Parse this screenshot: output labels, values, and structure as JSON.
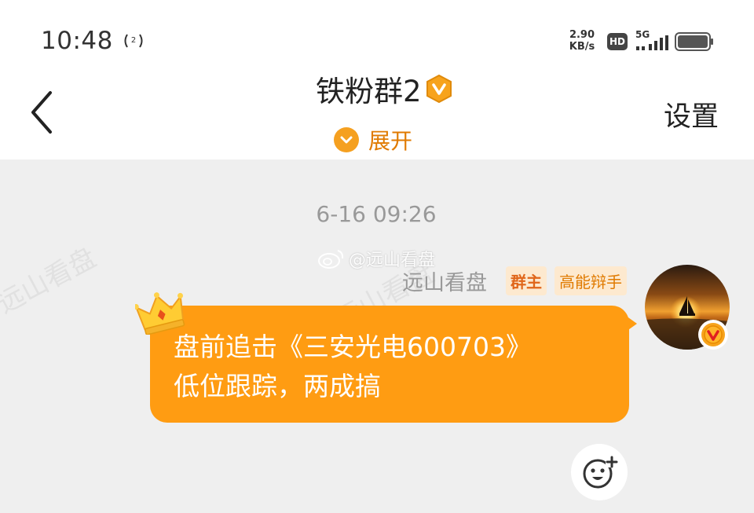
{
  "status_bar": {
    "time": "10:48",
    "speed_value": "2.90",
    "speed_unit": "KB/s",
    "hd_label": "HD",
    "network_label": "5G"
  },
  "header": {
    "title": "铁粉群2",
    "expand_label": "展开",
    "settings_label": "设置"
  },
  "chat": {
    "timestamp": "6-16 09:26",
    "watermark": "@远山看盘",
    "message": {
      "sender": "远山看盘",
      "tags": [
        "群主",
        "高能辩手"
      ],
      "lines": [
        "盘前追击《三安光电600703》",
        "低位跟踪，两成搞"
      ]
    }
  },
  "colors": {
    "accent": "#ff9c12",
    "expand_orange": "#e07a00",
    "tag_bg": "#fde9cf",
    "chat_bg": "#efefef"
  },
  "icons": [
    "hotspot-icon",
    "signal-icon",
    "battery-icon",
    "back-icon",
    "verified-badge-icon",
    "chevron-down-icon",
    "crown-icon",
    "emoji-add-icon",
    "weibo-logo-icon"
  ]
}
